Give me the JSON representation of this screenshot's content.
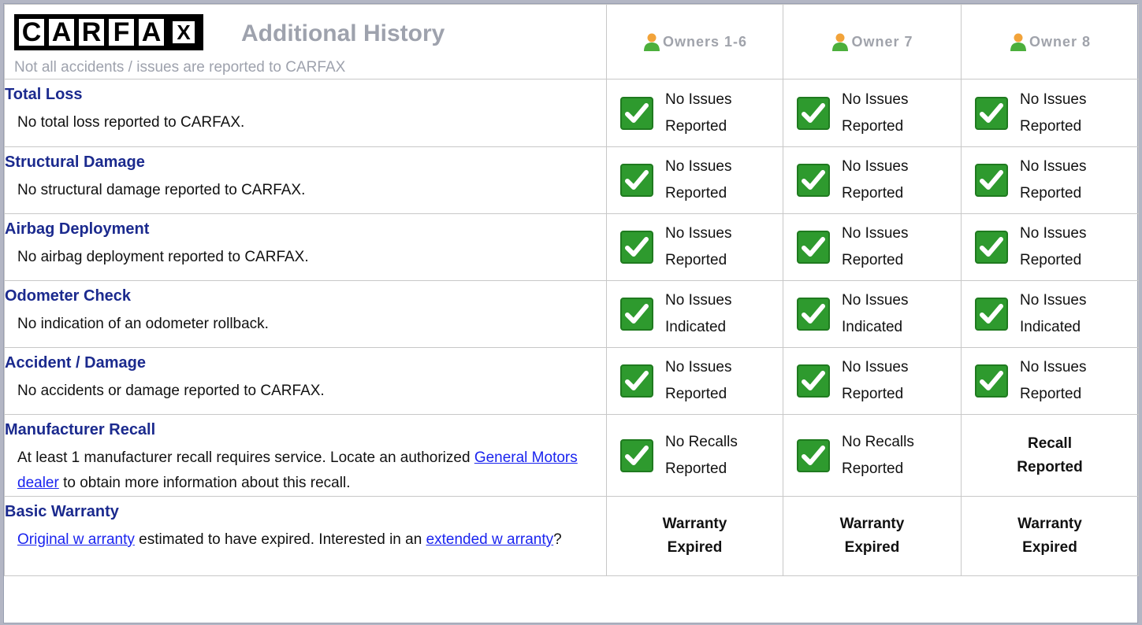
{
  "header": {
    "logo_letters": [
      "C",
      "A",
      "R",
      "F",
      "A",
      "X"
    ],
    "title": "Additional History",
    "note": "Not all accidents / issues are reported to CARFAX",
    "owners": [
      "Owners 1-6",
      "Owner 7",
      "Owner 8"
    ]
  },
  "colors": {
    "category_title": "#1b2a8e",
    "link": "#1a24ef",
    "check_green": "#2e9a2e",
    "header_gray": "#9ea2ad"
  },
  "rows": [
    {
      "title": "Total Loss",
      "desc": "No total loss reported to CARFAX.",
      "status": [
        "No Issues Reported",
        "No Issues Reported",
        "No Issues Reported"
      ]
    },
    {
      "title": "Structural Damage",
      "desc": "No structural damage reported to CARFAX.",
      "status": [
        "No Issues Reported",
        "No Issues Reported",
        "No Issues Reported"
      ]
    },
    {
      "title": "Airbag Deployment",
      "desc": "No airbag deployment reported to CARFAX.",
      "status": [
        "No Issues Reported",
        "No Issues Reported",
        "No Issues Reported"
      ]
    },
    {
      "title": "Odometer Check",
      "desc": "No indication of an odometer rollback.",
      "status": [
        "No Issues Indicated",
        "No Issues Indicated",
        "No Issues Indicated"
      ]
    },
    {
      "title": "Accident / Damage",
      "desc": "No accidents or damage reported to CARFAX.",
      "status": [
        "No Issues Reported",
        "No Issues Reported",
        "No Issues Reported"
      ]
    },
    {
      "title": "Manufacturer Recall",
      "desc_before": "At least 1 manufacturer recall requires service. Locate an authorized",
      "desc_link": "General Motors dealer",
      "desc_after": "to obtain more information about this recall.",
      "status": [
        "No Recalls Reported",
        "No Recalls Reported",
        "Recall Reported"
      ]
    },
    {
      "title": "Basic Warranty",
      "desc_link1": "Original w arranty",
      "desc_middle": "estimated to have expired. Interested in an",
      "desc_link2": "extended w arranty",
      "desc_end": "?",
      "status": [
        "Warranty Expired",
        "Warranty Expired",
        "Warranty Expired"
      ]
    }
  ]
}
